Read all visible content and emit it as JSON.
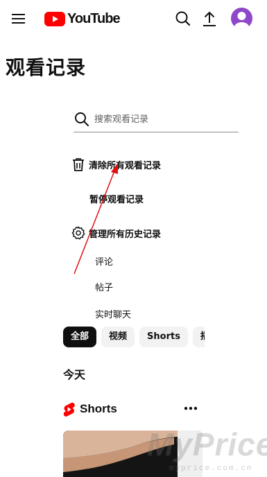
{
  "header": {
    "logo_text": "YouTube",
    "brand_color": "#ff0000",
    "avatar_color": "#8e47c9"
  },
  "page": {
    "title": "观看记录"
  },
  "search": {
    "placeholder": "搜索观看记录"
  },
  "actions": {
    "clear_all": "清除所有观看记录",
    "pause": "暂停观看记录",
    "manage_all": "管理所有历史记录"
  },
  "history_links": {
    "comments": "评论",
    "posts": "帖子",
    "live_chat": "实时聊天"
  },
  "filter_chips": [
    {
      "label": "全部",
      "selected": true
    },
    {
      "label": "视频",
      "selected": false
    },
    {
      "label": "Shorts",
      "selected": false
    },
    {
      "label": "播",
      "selected": false
    }
  ],
  "feed": {
    "section_today": "今天",
    "shorts_label": "Shorts"
  },
  "watermark": {
    "big": "MyPrice",
    "small": "myprice.com.cn"
  }
}
